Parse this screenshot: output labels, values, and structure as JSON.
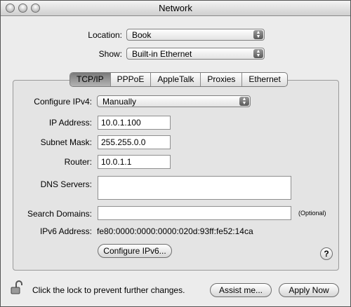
{
  "window": {
    "title": "Network"
  },
  "location": {
    "label": "Location:",
    "value": "Book"
  },
  "show": {
    "label": "Show:",
    "value": "Built-in Ethernet"
  },
  "tabs": [
    {
      "label": "TCP/IP",
      "selected": true
    },
    {
      "label": "PPPoE",
      "selected": false
    },
    {
      "label": "AppleTalk",
      "selected": false
    },
    {
      "label": "Proxies",
      "selected": false
    },
    {
      "label": "Ethernet",
      "selected": false
    }
  ],
  "tcpip": {
    "configure_ipv4": {
      "label": "Configure IPv4:",
      "value": "Manually"
    },
    "ip_address": {
      "label": "IP Address:",
      "value": "10.0.1.100"
    },
    "subnet_mask": {
      "label": "Subnet Mask:",
      "value": "255.255.0.0"
    },
    "router": {
      "label": "Router:",
      "value": "10.0.1.1"
    },
    "dns_servers": {
      "label": "DNS Servers:",
      "value": ""
    },
    "search_domains": {
      "label": "Search Domains:",
      "value": "",
      "hint": "(Optional)"
    },
    "ipv6_address": {
      "label": "IPv6 Address:",
      "value": "fe80:0000:0000:0000:020d:93ff:fe52:14ca"
    },
    "configure_ipv6_button": "Configure IPv6...",
    "help_symbol": "?"
  },
  "footer": {
    "lock_text": "Click the lock to prevent further changes.",
    "assist_button": "Assist me...",
    "apply_button": "Apply Now"
  },
  "icons": {
    "lock": "lock-open-icon",
    "popup_arrows": "popup-arrows-icon",
    "help": "help-icon"
  },
  "colors": {
    "window_bg": "#ececec",
    "tab_selected": "#9a9a9a"
  }
}
